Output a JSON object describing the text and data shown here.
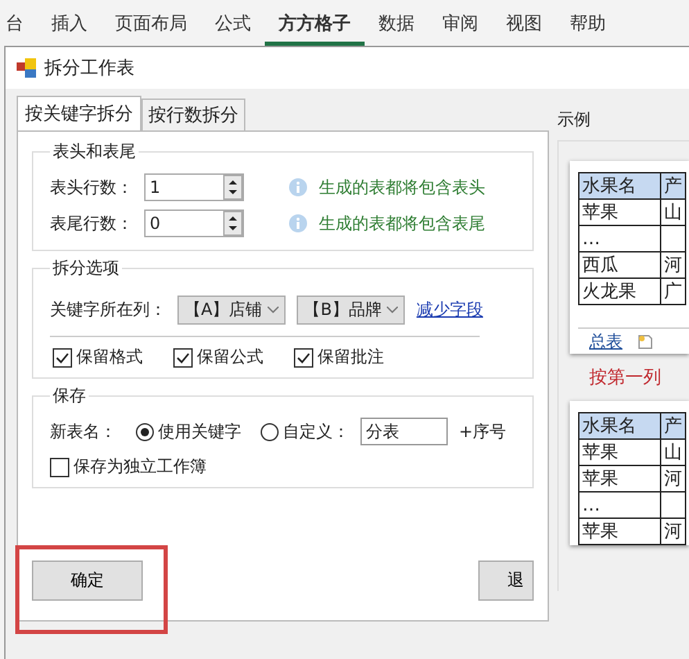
{
  "ribbon_tabs": [
    {
      "label": "台",
      "selected": false
    },
    {
      "label": "插入",
      "selected": false
    },
    {
      "label": "页面布局",
      "selected": false
    },
    {
      "label": "公式",
      "selected": false
    },
    {
      "label": "方方格子",
      "selected": true
    },
    {
      "label": "数据",
      "selected": false
    },
    {
      "label": "审阅",
      "selected": false
    },
    {
      "label": "视图",
      "selected": false
    },
    {
      "label": "帮助",
      "selected": false
    }
  ],
  "window": {
    "title": "拆分工作表"
  },
  "tabs": [
    {
      "label": "按关键字拆分",
      "selected": true
    },
    {
      "label": "按行数拆分",
      "selected": false
    }
  ],
  "header_footer": {
    "title": "表头和表尾",
    "rows": [
      {
        "label": "表头行数：",
        "value": "1",
        "hint": "生成的表都将包含表头"
      },
      {
        "label": "表尾行数：",
        "value": "0",
        "hint": "生成的表都将包含表尾"
      }
    ]
  },
  "split_options": {
    "title": "拆分选项",
    "key_label": "关键字所在列：",
    "dropdowns": [
      "【A】店铺",
      "【B】品牌"
    ],
    "link": "减少字段",
    "checkboxes": [
      {
        "label": "保留格式",
        "checked": true
      },
      {
        "label": "保留公式",
        "checked": true
      },
      {
        "label": "保留批注",
        "checked": true
      }
    ]
  },
  "save": {
    "title": "保存",
    "name_label": "新表名：",
    "radios": [
      {
        "label": "使用关键字",
        "selected": true
      },
      {
        "label": "自定义：",
        "selected": false
      }
    ],
    "custom_name": "分表",
    "suffix": "+序号",
    "separate_workbook": {
      "label": "保存为独立工作簿",
      "checked": false
    }
  },
  "buttons": {
    "ok": "确定",
    "exit": "退"
  },
  "example": {
    "title": "示例",
    "source_table": [
      [
        "水果名",
        "产"
      ],
      [
        "苹果",
        "山"
      ],
      [
        "…"
      ],
      [
        "西瓜",
        "河"
      ],
      [
        "火龙果",
        "广"
      ]
    ],
    "sheet_tab": "总表",
    "caption": "按第一列",
    "result_table": [
      [
        "水果名",
        "产"
      ],
      [
        "苹果",
        "山"
      ],
      [
        "苹果",
        "河"
      ],
      [
        "…"
      ],
      [
        "苹果",
        "河"
      ]
    ]
  }
}
